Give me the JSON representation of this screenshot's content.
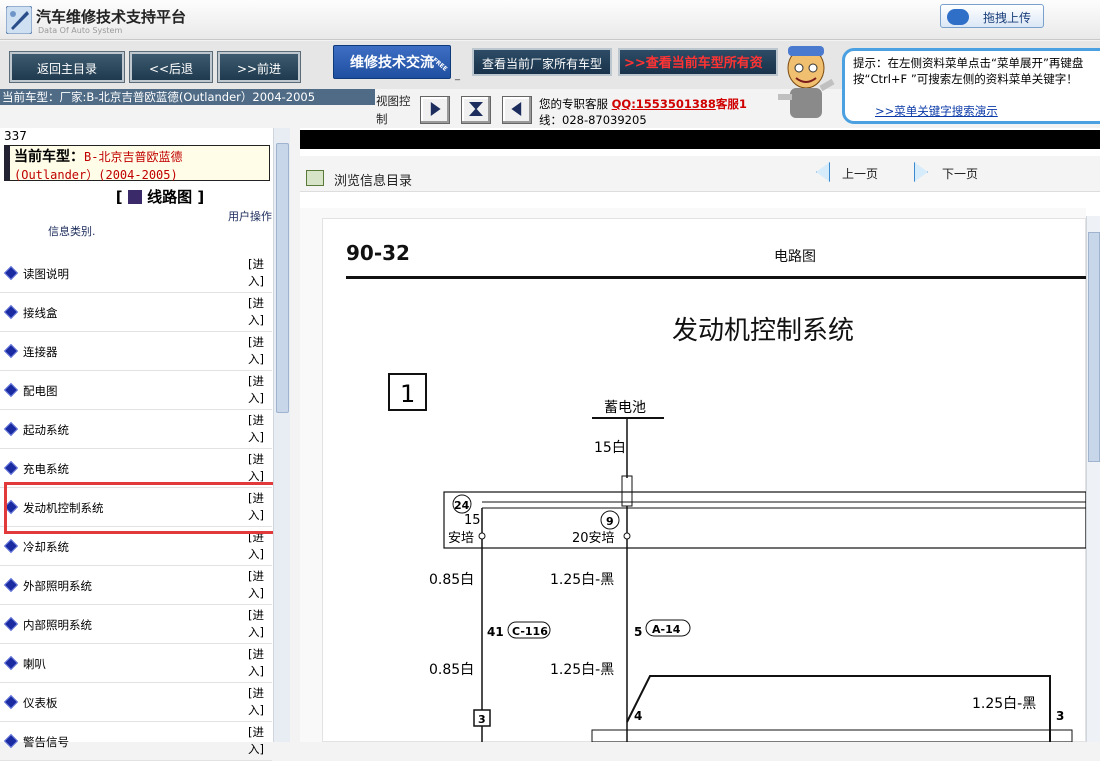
{
  "app": {
    "title": "汽车维修技术支持平台",
    "subtitle": "Data Of Auto System",
    "upload_label": "拖拽上传"
  },
  "nav": {
    "home": "返回主目录",
    "back": "<<后退",
    "forward": ">>前进",
    "forum": "维修技术交流",
    "forum_badge": "FREE",
    "maker_models": "查看当前厂家所有车型",
    "model_all": "查看当前车型所有资"
  },
  "tip": {
    "text": "提示：在左侧资料菜单点击“菜单展开”再键盘按“Ctrl+F ”可搜索左侧的资料菜单关键字！",
    "link": ">>菜单关键字搜索演示"
  },
  "info": {
    "current": "当前车型：厂家:B-北京吉普欧蓝德(Outlander）2004-2005",
    "view_ctl": "视图控制",
    "kefu_label": "您的专职客服",
    "kefu_qq": "QQ:1553501388",
    "kefu_2": "客服1",
    "kefu_line2": "线：028-87039205"
  },
  "left": {
    "count": "337",
    "model_label": "当前车型：",
    "model_value": "B-北京吉普欧蓝德",
    "model_value2": "(Outlander）(2004-2005)",
    "section": "线路图",
    "col_category": "信息类别.",
    "col_action": "用户操作",
    "enter": "[进入]",
    "items": [
      "读图说明",
      "接线盒",
      "连接器",
      "配电图",
      "起动系统",
      "充电系统",
      "发动机控制系统",
      "冷却系统",
      "外部照明系统",
      "内部照明系统",
      "喇叭",
      "仪表板",
      "警告信号"
    ]
  },
  "right": {
    "browse": "浏览信息目录",
    "prev": "上一页",
    "next": "下一页"
  },
  "doc": {
    "page_no": "90-32",
    "page_head": "电路图",
    "title": "发动机控制系统",
    "box_no": "1",
    "battery": "蓄电池",
    "w1": "15白",
    "conn24": "24",
    "amp15": "15",
    "unit_a": "安培",
    "conn9": "9",
    "amp20": "20安培",
    "w2": "0.85白",
    "w3": "1.25白-黑",
    "pin41": "41",
    "c116": "C-116",
    "pin5": "5",
    "a14": "A-14",
    "w4": "0.85白",
    "w5": "1.25白-黑",
    "w6": "1.25白-黑",
    "pin4": "4",
    "pin3": "3",
    "pin3b": "3"
  },
  "colors": {
    "accent": "#1f4fa0",
    "highlight": "#e23a3a",
    "link": "#0b3aa8"
  }
}
